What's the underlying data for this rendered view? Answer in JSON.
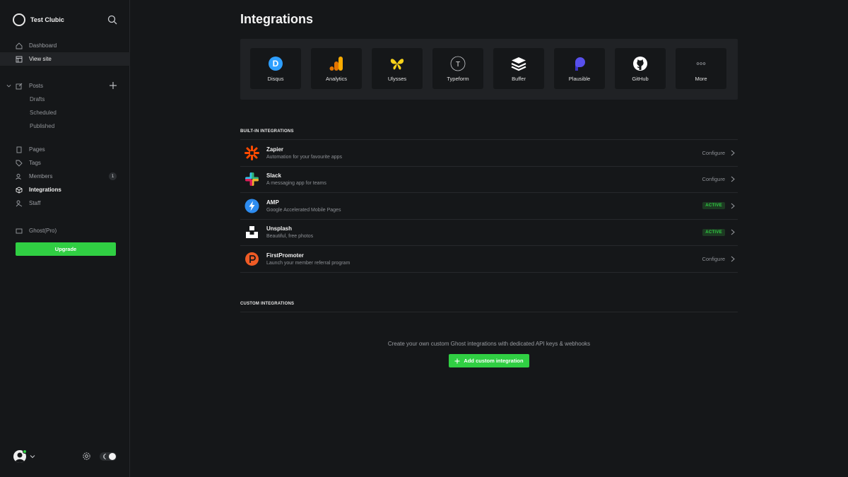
{
  "brand": {
    "name": "Test Clubic"
  },
  "sidebar": {
    "nav": [
      {
        "label": "Dashboard",
        "icon": "home-icon"
      },
      {
        "label": "View site",
        "icon": "layout-icon"
      }
    ],
    "posts": {
      "label": "Posts",
      "sub": [
        "Drafts",
        "Scheduled",
        "Published"
      ]
    },
    "nav2": [
      {
        "label": "Pages",
        "icon": "pages-icon"
      },
      {
        "label": "Tags",
        "icon": "tag-icon"
      },
      {
        "label": "Members",
        "icon": "members-icon",
        "badge": "1"
      },
      {
        "label": "Integrations",
        "icon": "integrations-icon"
      },
      {
        "label": "Staff",
        "icon": "staff-icon"
      }
    ],
    "ghost_pro": "Ghost(Pro)",
    "upgrade": "Upgrade"
  },
  "main": {
    "title": "Integrations",
    "tiles": [
      {
        "label": "Disqus",
        "icon": "disqus-icon"
      },
      {
        "label": "Analytics",
        "icon": "analytics-icon"
      },
      {
        "label": "Ulysses",
        "icon": "ulysses-icon"
      },
      {
        "label": "Typeform",
        "icon": "typeform-icon"
      },
      {
        "label": "Buffer",
        "icon": "buffer-icon"
      },
      {
        "label": "Plausible",
        "icon": "plausible-icon"
      },
      {
        "label": "GitHub",
        "icon": "github-icon"
      },
      {
        "label": "More",
        "icon": "more-icon"
      }
    ],
    "builtin_heading": "BUILT-IN INTEGRATIONS",
    "builtin": [
      {
        "name": "Zapier",
        "desc": "Automation for your favourite apps",
        "status": "Configure",
        "icon": "zapier-icon"
      },
      {
        "name": "Slack",
        "desc": "A messaging app for teams",
        "status": "Configure",
        "icon": "slack-icon"
      },
      {
        "name": "AMP",
        "desc": "Google Accelerated Mobile Pages",
        "status": "ACTIVE",
        "icon": "amp-icon"
      },
      {
        "name": "Unsplash",
        "desc": "Beautiful, free photos",
        "status": "ACTIVE",
        "icon": "unsplash-icon"
      },
      {
        "name": "FirstPromoter",
        "desc": "Launch your member referral program",
        "status": "Configure",
        "icon": "firstpromoter-icon"
      }
    ],
    "custom_heading": "CUSTOM INTEGRATIONS",
    "custom_text": "Create your own custom Ghost integrations with dedicated API keys & webhooks",
    "add_custom": "Add custom integration"
  },
  "colors": {
    "accent": "#30cf43",
    "bg": "#151719",
    "panel": "#202225"
  }
}
